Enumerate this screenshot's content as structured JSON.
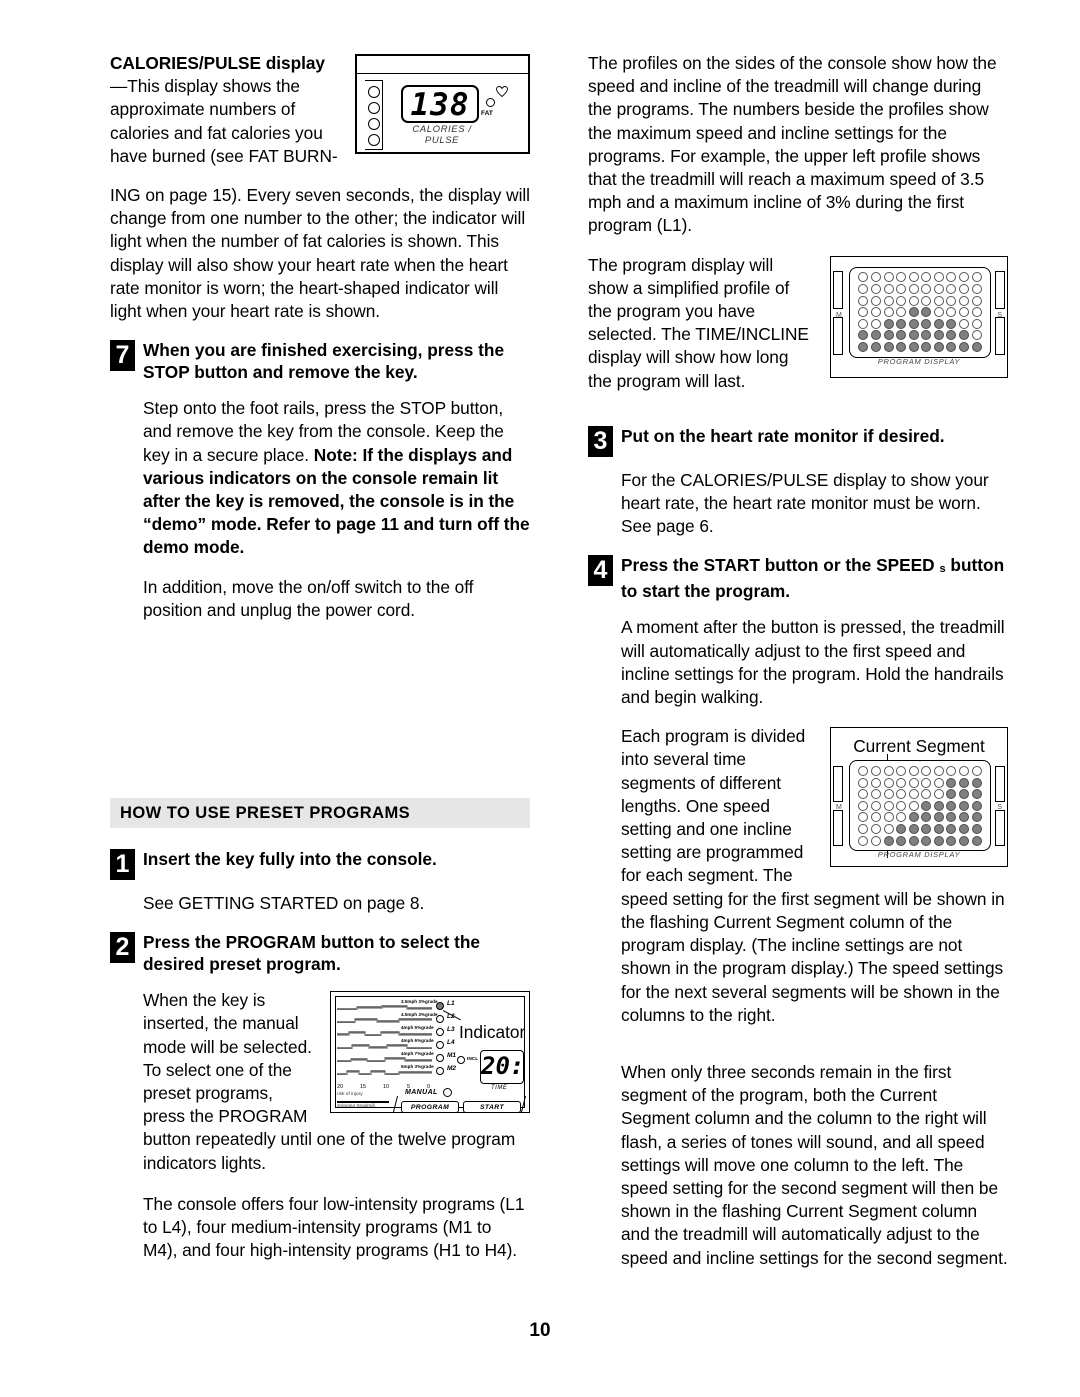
{
  "document": {
    "page_number": "10"
  },
  "left_column": {
    "calories_heading_bold_1": "CALORIES/PULSE",
    "calories_heading_bold_2": "display",
    "calories_heading_rest": "—This display shows the approximate numbers of calories and fat calories you have burned (see FAT BURN-",
    "calories_paragraph_cont": "ING on page 15). Every seven seconds, the display will change from one number to the other; the indicator will light when the number of fat calories is shown. This display will also show your heart rate when the heart rate monitor is worn; the heart-shaped indicator will light when your heart rate is shown.",
    "step7_num": "7",
    "step7_heading": "When you are finished exercising, press the STOP button and remove the key.",
    "step7_body_part1": "Step onto the foot rails, press the STOP button, and remove the key from the console. Keep the key in a secure place. ",
    "step7_body_bold": "Note: If the displays and various indicators on the console remain lit after the key is removed, the console is in the “demo” mode. Refer to page 11 and turn off the demo mode.",
    "step7_body_part2": "In addition, move the on/off switch to the off position and unplug the power cord.",
    "section_header": "HOW TO USE PRESET PROGRAMS",
    "step1_num": "1",
    "step1_heading": "Insert the key fully into the console.",
    "step1_body": "See GETTING STARTED on page 8.",
    "step2_num": "2",
    "step2_heading": "Press the PROGRAM button to select the desired preset program.",
    "step2_body_wrap": "When the key is inserted, the manual mode will be selected. To select one of the preset programs, press the PROGRAM button repeatedly until one of the twelve program indicators lights.",
    "step2_body_after": "The console offers four low-intensity programs (L1 to L4), four medium-intensity programs (M1 to M4), and four high-intensity programs (H1 to H4)."
  },
  "right_column": {
    "para_profiles": "The profiles on the sides of the console show how the speed and incline of the treadmill will change during the programs. The numbers beside the profiles show the maximum speed and incline settings for the programs. For example, the upper left profile shows that the treadmill will reach a maximum speed of 3.5 mph and a maximum incline of 3% during the first program (L1).",
    "para_program_display": "The program display will show a simplified profile of the program you have selected. The TIME/INCLINE display will show how long the program will last.",
    "step3_num": "3",
    "step3_heading": "Put on the heart rate monitor if desired.",
    "step3_body": "For the CALORIES/PULSE display to show your heart rate, the heart rate monitor must be worn. See page 6.",
    "step4_num": "4",
    "step4_heading_a": "Press the START button or the SPEED",
    "step4_symbol": "s",
    "step4_heading_b": "button to start the program.",
    "step4_body": "A moment after the button is pressed, the treadmill will automatically adjust to the first speed and incline settings for the program. Hold the handrails and begin walking.",
    "para_segments": "Each program is divided into several time segments of different lengths. One speed setting and one incline setting are programmed for each segment. The speed setting for the first segment will be shown in the flashing Current Segment column of the program display. (The incline settings are not shown in the program display.) The speed settings for the next several segments will be shown in the columns to the right.",
    "para_three_seconds": "When only three seconds remain in the first segment of the program, both the Current Segment column and the column to the right will flash, a series of tones will sound, and all speed settings will move one column to the left. The speed setting for the second segment will then be shown in the flashing Current Segment column and the treadmill will automatically adjust to the speed and incline settings for the second segment."
  },
  "figures": {
    "calories_display": {
      "digits": "138",
      "caption": "CALORIES / PULSE",
      "fat_label": "FAT",
      "heart_icon": "heart-indicator-icon",
      "indicator_dots_count": 4
    },
    "program_display_1": {
      "caption": "PROGRAM DISPLAY",
      "rows": 7,
      "cols": 10,
      "pattern": [
        [
          0,
          0,
          0,
          0,
          0,
          0,
          0,
          0,
          0,
          0
        ],
        [
          0,
          0,
          0,
          0,
          0,
          0,
          0,
          0,
          0,
          0
        ],
        [
          0,
          0,
          0,
          0,
          0,
          0,
          0,
          0,
          0,
          0
        ],
        [
          0,
          0,
          0,
          0,
          1,
          1,
          0,
          0,
          0,
          0
        ],
        [
          0,
          0,
          1,
          1,
          1,
          1,
          1,
          1,
          0,
          0
        ],
        [
          1,
          1,
          1,
          1,
          1,
          1,
          1,
          1,
          1,
          0
        ],
        [
          1,
          1,
          1,
          1,
          1,
          1,
          1,
          1,
          1,
          1
        ]
      ],
      "edge_left_letter": "M",
      "edge_right_letter": "S"
    },
    "program_display_2": {
      "label": "Current Segment",
      "caption": "PROGRAM DISPLAY",
      "rows": 7,
      "cols": 10,
      "pointer_column": 3,
      "pattern": [
        [
          0,
          0,
          0,
          0,
          0,
          0,
          0,
          0,
          0,
          0
        ],
        [
          0,
          0,
          0,
          0,
          0,
          0,
          0,
          1,
          1,
          1
        ],
        [
          0,
          0,
          0,
          0,
          0,
          0,
          0,
          1,
          1,
          1
        ],
        [
          0,
          0,
          0,
          0,
          0,
          1,
          1,
          1,
          1,
          1
        ],
        [
          0,
          0,
          0,
          0,
          1,
          1,
          1,
          1,
          1,
          1
        ],
        [
          0,
          0,
          0,
          1,
          1,
          1,
          1,
          1,
          1,
          1
        ],
        [
          0,
          0,
          1,
          1,
          1,
          1,
          1,
          1,
          1,
          1
        ]
      ],
      "edge_left_letter": "M",
      "edge_right_letter": "S"
    },
    "console": {
      "indicator_callout": "Indicator",
      "profile_rows": [
        {
          "speed_label": "3.5mph 3%grade",
          "program": "L1",
          "lit": true
        },
        {
          "speed_label": "4.5mph 3%grade",
          "program": "L2",
          "lit": false
        },
        {
          "speed_label": "4mph 5%grade",
          "program": "L3",
          "lit": false
        },
        {
          "speed_label": "4mph 6%grade",
          "program": "L4",
          "lit": false
        },
        {
          "speed_label": "4mph 7%grade",
          "program": "M1",
          "lit": false
        },
        {
          "speed_label": "5mph 3%grade",
          "program": "M2",
          "lit": false
        }
      ],
      "axis_labels": [
        "20",
        "15",
        "10",
        "5",
        "0"
      ],
      "time_value": "20:",
      "time_label": "TIME",
      "incline_label": "INCL",
      "manual_label": "MANUAL",
      "buttons": [
        "PROGRAM",
        "START"
      ],
      "warning_line1": "risk of injury.",
      "warning_line2": "stopping treadmill."
    }
  }
}
